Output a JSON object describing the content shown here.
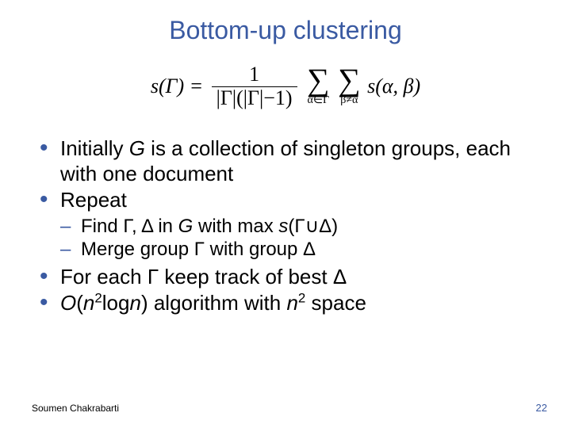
{
  "title": "Bottom-up clustering",
  "formula": {
    "lhs": "s(Γ) =",
    "frac_num": "1",
    "frac_den": "|Γ|(|Γ|−1)",
    "sigma1_sub": "α∈Γ",
    "sigma2_sub": "β≠α",
    "rhs": "s(α, β)"
  },
  "bullets": {
    "b1_pre": "Initially ",
    "b1_G": "G",
    "b1_post": " is a collection of singleton groups, each with one document",
    "b2": "Repeat",
    "b2a_pre": "Find Γ, Δ in ",
    "b2a_G": "G",
    "b2a_mid": " with max ",
    "b2a_s": "s",
    "b2a_paren": "(Γ∪Δ)",
    "b2b": "Merge group Γ with group Δ",
    "b3": "For each Γ keep track of best Δ",
    "b4_O": "O",
    "b4_open": "(",
    "b4_n1": "n",
    "b4_exp1": "2",
    "b4_mid": "log",
    "b4_n2": "n",
    "b4_close": ")  algorithm with ",
    "b4_n3": "n",
    "b4_exp2": "2",
    "b4_end": " space"
  },
  "footer": {
    "author": "Soumen Chakrabarti",
    "page": "22"
  }
}
